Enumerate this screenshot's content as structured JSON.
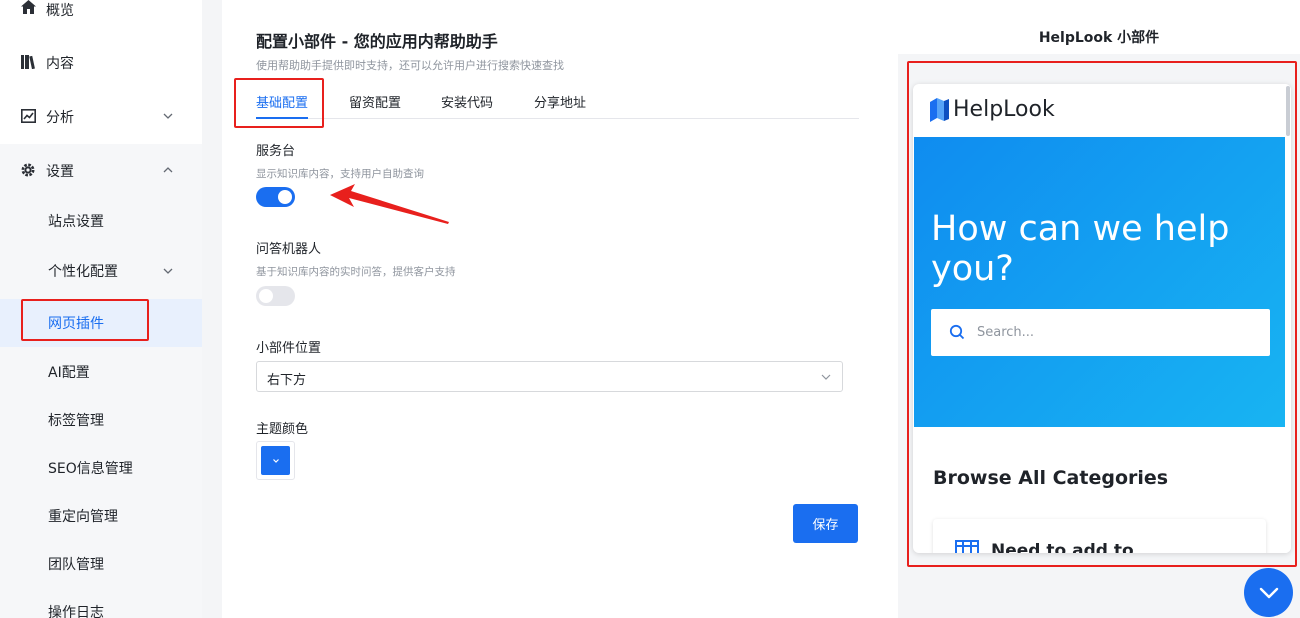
{
  "sidebar": {
    "items": [
      {
        "label": "概览",
        "icon": "home-icon"
      },
      {
        "label": "内容",
        "icon": "book-icon"
      },
      {
        "label": "分析",
        "icon": "chart-icon"
      },
      {
        "label": "设置",
        "icon": "gear-icon"
      }
    ],
    "sub_items": [
      {
        "label": "站点设置"
      },
      {
        "label": "个性化配置"
      },
      {
        "label": "网页插件",
        "active": true
      },
      {
        "label": "AI配置"
      },
      {
        "label": "标签管理"
      },
      {
        "label": "SEO信息管理"
      },
      {
        "label": "重定向管理"
      },
      {
        "label": "团队管理"
      },
      {
        "label": "操作日志"
      }
    ]
  },
  "main": {
    "title": "配置小部件 - 您的应用内帮助助手",
    "subtitle": "使用帮助助手提供即时支持，还可以允许用户进行搜索快速查找",
    "tabs": [
      {
        "label": "基础配置",
        "active": true
      },
      {
        "label": "留资配置"
      },
      {
        "label": "安装代码"
      },
      {
        "label": "分享地址"
      }
    ],
    "service_desk": {
      "label": "服务台",
      "desc": "显示知识库内容，支持用户自助查询",
      "enabled": true
    },
    "qa_bot": {
      "label": "问答机器人",
      "desc": "基于知识库内容的实时问答，提供客户支持",
      "enabled": false
    },
    "position": {
      "label": "小部件位置",
      "value": "右下方"
    },
    "theme_color": {
      "label": "主题颜色",
      "value": "#1a6ef0"
    },
    "save_label": "保存"
  },
  "preview": {
    "title": "HelpLook 小部件",
    "logo_text": "HelpLook",
    "hero_text": "How can we help you?",
    "search_placeholder": "Search...",
    "browse_title": "Browse All Categories",
    "card_text": "Need to add to",
    "colors": {
      "hero_start": "#0f8cf0",
      "hero_end": "#18b4f2",
      "fab": "#1a6ef0"
    }
  },
  "colors": {
    "accent": "#1a6ef0",
    "annotation": "#e8201d"
  }
}
